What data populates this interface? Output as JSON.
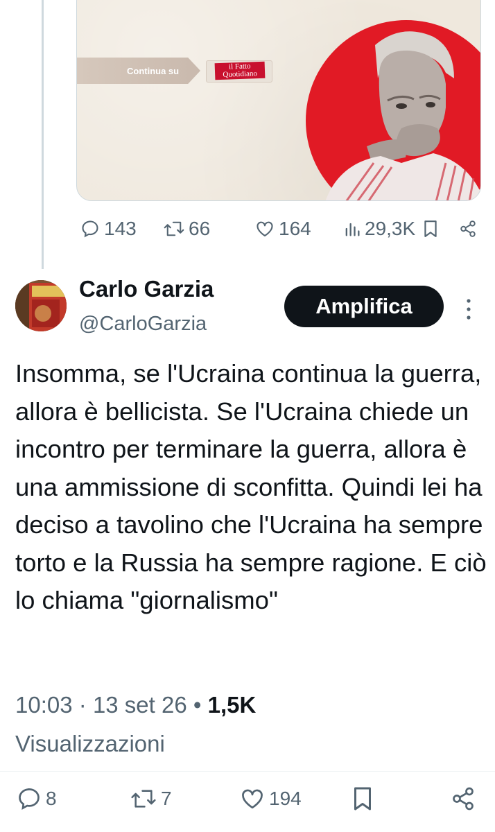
{
  "quoted_media": {
    "continue_label": "Continua su",
    "logo_text": "il Fatto Quotidiano"
  },
  "first_tweet_actions": {
    "replies": "143",
    "reposts": "66",
    "likes": "164",
    "views": "29,3K"
  },
  "reply_tweet": {
    "author_name": "Carlo Garzia",
    "author_handle": "@CarloGarzia",
    "follow_button": "Amplifica",
    "body": "Insomma, se l'Ucraina continua la guerra, allora è bellicista. Se l'Ucraina chiede un incontro per terminare la guerra, allora è una ammissione di sconfitta. Quindi lei ha deciso a tavolino che l'Ucraina ha sempre torto e la Russia ha sempre ragione. E ciò lo chiama \"giornalismo\"",
    "time": "10:03",
    "date": "13 set 26",
    "views_count": "1,5K",
    "views_label": "Visualizzazioni",
    "separator_dot": "·",
    "bullet": "•"
  },
  "reply_tweet_actions": {
    "replies": "8",
    "reposts": "7",
    "likes": "194"
  },
  "colors": {
    "text": "#0f1419",
    "muted": "#536471",
    "accent_red": "#e11a25",
    "button_bg": "#0f1419"
  },
  "icons": [
    "reply-icon",
    "repost-icon",
    "like-icon",
    "views-icon",
    "bookmark-icon",
    "share-icon",
    "more-icon"
  ]
}
